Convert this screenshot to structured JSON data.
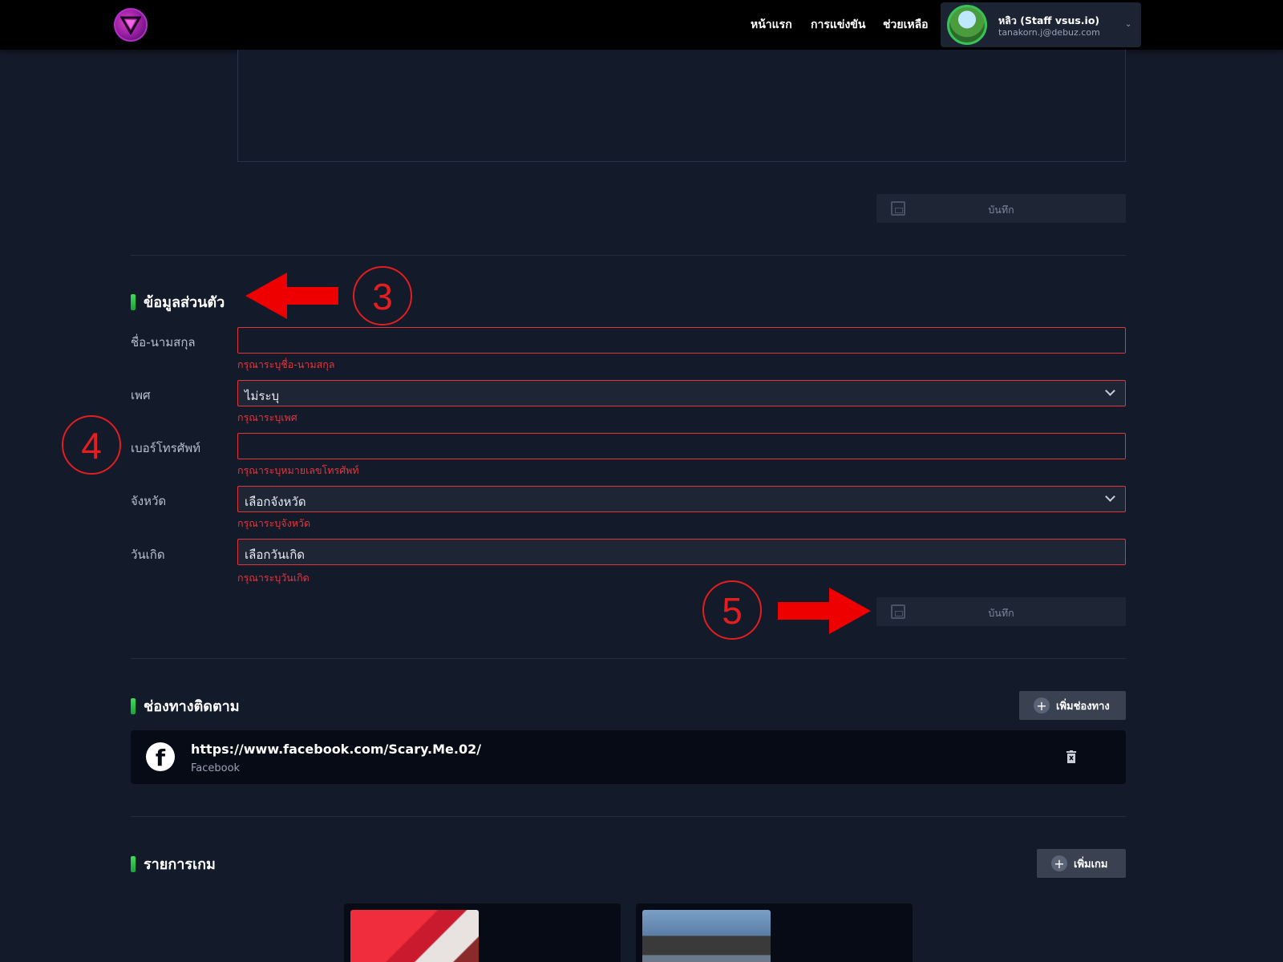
{
  "nav": {
    "home": "หน้าแรก",
    "competition": "การแข่งขัน",
    "help": "ช่วยเหลือ",
    "user_name": "หลิว (Staff vsus.io)",
    "user_email": "tanakorn.j@debuz.com"
  },
  "save_label": "บันทึก",
  "personal": {
    "title": "ข้อมูลส่วนตัว",
    "fields": [
      {
        "label": "ชื่อ-นามสกุล",
        "value": "",
        "error": "กรุณาระบุชื่อ-นามสกุล"
      },
      {
        "label": "เพศ",
        "value": "ไม่ระบุ",
        "error": "กรุณาระบุเพศ"
      },
      {
        "label": "เบอร์โทรศัพท์",
        "value": "",
        "error": "กรุณาระบุหมายเลขโทรศัพท์"
      },
      {
        "label": "จังหวัด",
        "value": "เลือกจังหวัด",
        "error": "กรุณาระบุจังหวัด"
      },
      {
        "label": "วันเกิด",
        "value": "เลือกวันเกิด",
        "error": "กรุณาระบุวันเกิด"
      }
    ]
  },
  "channels": {
    "title": "ช่องทางติดตาม",
    "add_label": "เพิ่มช่องทาง",
    "items": [
      {
        "url": "https://www.facebook.com/Scary.Me.02/",
        "type": "Facebook"
      }
    ]
  },
  "games": {
    "title": "รายการเกม",
    "add_label": "เพิ่มเกม"
  },
  "annotations": {
    "a3": "3",
    "a4": "4",
    "a5": "5",
    "color": "#e41e1e"
  },
  "colors": {
    "error": "#e8353b",
    "accent_green": "#3be05a",
    "background": "#131a2a"
  }
}
